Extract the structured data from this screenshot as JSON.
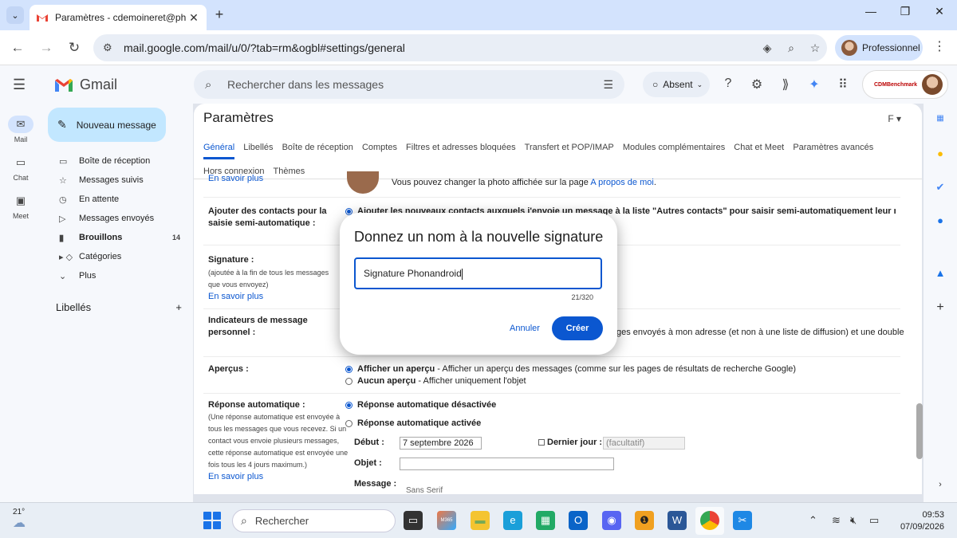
{
  "browser": {
    "tab_title": "Paramètres - cdemoineret@ph",
    "url": "mail.google.com/mail/u/0/?tab=rm&ogbl#settings/general",
    "profile_label": "Professionnel"
  },
  "gmail": {
    "logo_text": "Gmail",
    "search_placeholder": "Rechercher dans les messages",
    "status_label": "Absent",
    "account_brand": "CDMBenchmark"
  },
  "rail": {
    "mail": "Mail",
    "chat": "Chat",
    "meet": "Meet"
  },
  "sidebar": {
    "compose_label": "Nouveau message",
    "items": [
      {
        "label": "Boîte de réception",
        "count": ""
      },
      {
        "label": "Messages suivis",
        "count": ""
      },
      {
        "label": "En attente",
        "count": ""
      },
      {
        "label": "Messages envoyés",
        "count": ""
      },
      {
        "label": "Brouillons",
        "count": "14"
      },
      {
        "label": "Catégories",
        "count": ""
      },
      {
        "label": "Plus",
        "count": ""
      }
    ],
    "labels_title": "Libellés"
  },
  "settings": {
    "title": "Paramètres",
    "tabs": [
      "Général",
      "Libellés",
      "Boîte de réception",
      "Comptes",
      "Filtres et adresses bloquées",
      "Transfert et POP/IMAP",
      "Modules complémentaires",
      "Chat et Meet",
      "Paramètres avancés",
      "Hors connexion",
      "Thèmes"
    ],
    "learn_more": "En savoir plus",
    "photo_text": "Vous pouvez changer la photo affichée sur la page",
    "photo_link": "A propos de moi",
    "contacts_label": "Ajouter des contacts pour la saisie semi-automatique :",
    "contacts_value": "Ajouter les nouveaux contacts auxquels j'envoie un message à la liste \"Autres contacts\" pour saisir semi-automatiquement leur nom",
    "signature_label": "Signature :",
    "signature_sub": "(ajoutée à la fin de tous les messages que vous envoyez)",
    "indicators_label": "Indicateurs de message personnel :",
    "indicators_value": "ges envoyés à mon adresse (et non à une liste de diffusion) et une double",
    "preview_label": "Aperçus :",
    "preview_on_bold": "Afficher un aperçu",
    "preview_on_rest": " - Afficher un aperçu des messages (comme sur les pages de résultats de recherche Google)",
    "preview_off_bold": "Aucun aperçu",
    "preview_off_rest": " - Afficher uniquement l'objet",
    "auto_label": "Réponse automatique :",
    "auto_sub": "(Une réponse automatique est envoyée à tous les messages que vous recevez. Si un contact vous envoie plusieurs messages, cette réponse automatique est envoyée une fois tous les 4 jours maximum.)",
    "auto_off": "Réponse automatique désactivée",
    "auto_on": "Réponse automatique activée",
    "start_label": "Début :",
    "start_value": "7 septembre 2026",
    "last_day_label": "Dernier jour :",
    "last_day_placeholder": "(facultatif)",
    "subject_label": "Objet :",
    "message_label": "Message :",
    "font_label": "Sans Serif"
  },
  "dialog": {
    "title": "Donnez un nom à la nouvelle signature",
    "input_value": "Signature Phonandroid",
    "counter": "21/320",
    "cancel": "Annuler",
    "create": "Créer"
  },
  "taskbar": {
    "temperature": "21°",
    "search_label": "Rechercher",
    "m365_badge": "M365",
    "time": "09:53",
    "date": "07/09/2026"
  },
  "colors": {
    "accent": "#0b57d0",
    "compose_bg": "#c2e7ff",
    "chrome_bg": "#d3e3fd"
  }
}
